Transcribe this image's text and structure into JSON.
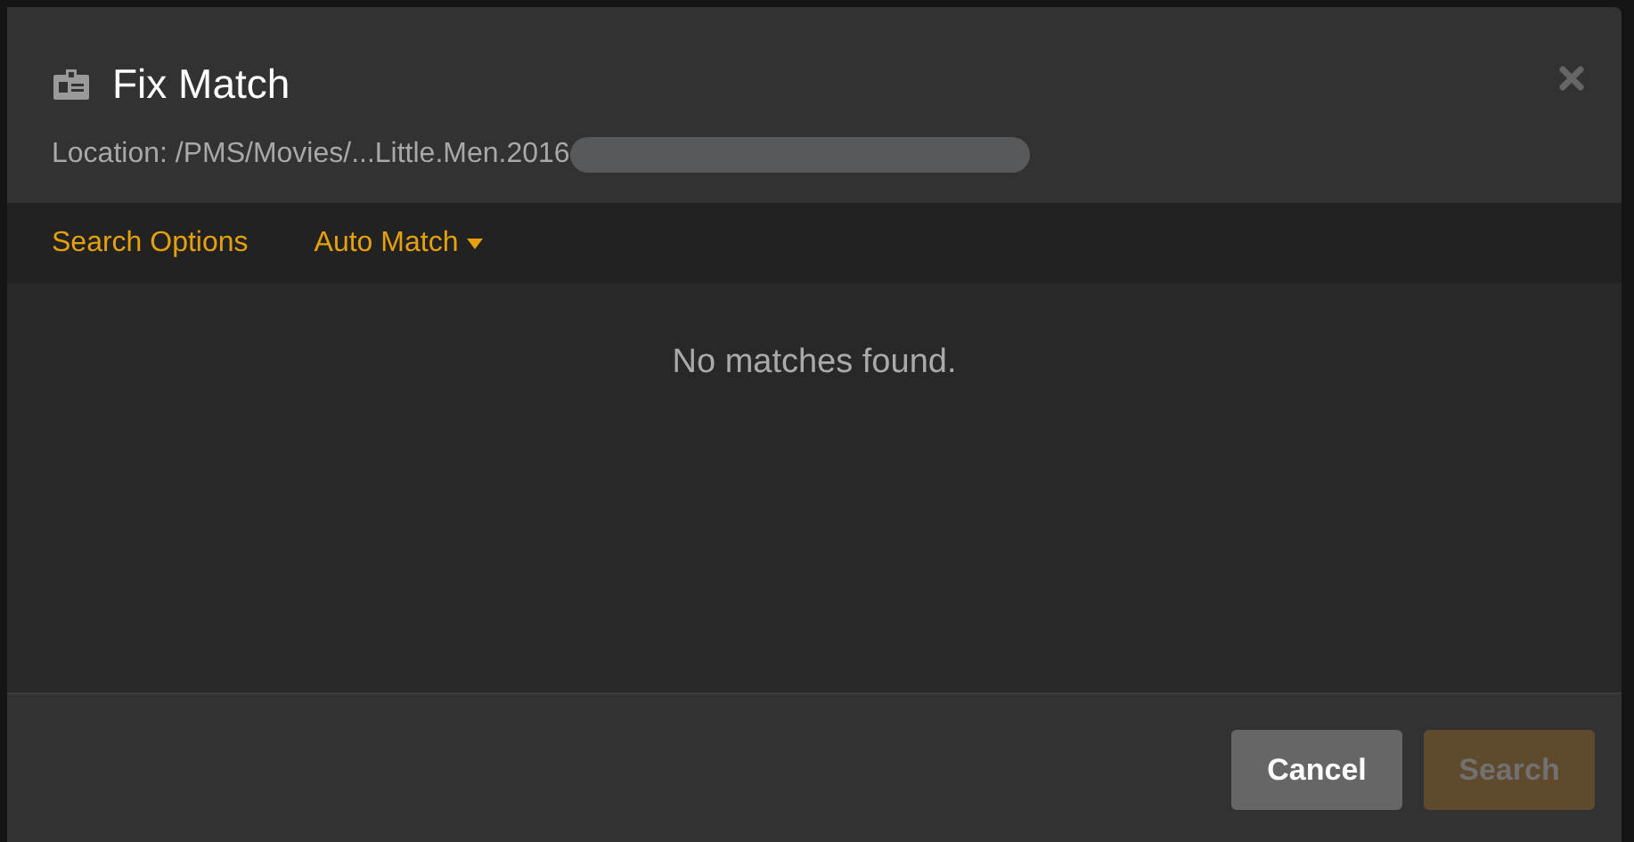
{
  "dialog": {
    "title": "Fix Match",
    "location": "Location: /PMS/Movies/...Little.Men.2016",
    "location_redacted": true
  },
  "tabs": [
    {
      "label": "Search Options",
      "dropdown": false
    },
    {
      "label": "Auto Match",
      "dropdown": true
    }
  ],
  "message": "No matches found.",
  "buttons": [
    {
      "label": "Cancel",
      "disabled": false
    },
    {
      "label": "Search",
      "disabled": true
    }
  ]
}
